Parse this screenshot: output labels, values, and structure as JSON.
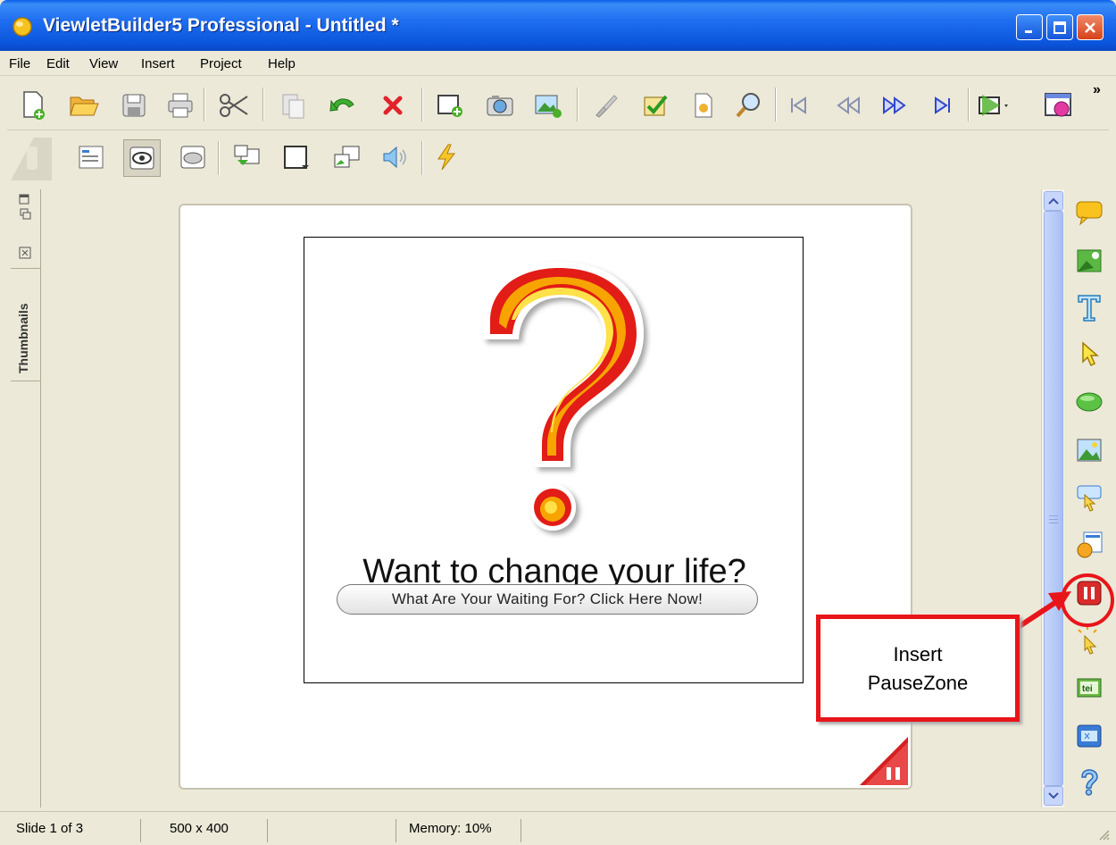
{
  "window": {
    "title": "ViewletBuilder5 Professional - Untitled *",
    "icon": "viewlet-app-icon"
  },
  "menu": [
    "File",
    "Edit",
    "View",
    "Insert",
    "Project",
    "Help"
  ],
  "toolbar_main": {
    "icons": [
      "new-file-icon",
      "open-folder-icon",
      "save-icon",
      "print-icon",
      "cut-icon",
      "paste-icon",
      "undo-icon",
      "delete-icon",
      "add-slide-icon",
      "camera-icon",
      "add-image-icon",
      "brush-icon",
      "spell-check-icon",
      "properties-icon",
      "find-icon",
      "first-slide-icon",
      "rewind-icon",
      "fast-forward-icon",
      "last-slide-icon",
      "preview-icon",
      "publish-icon"
    ],
    "overflow": "»"
  },
  "toolbar_secondary": {
    "icons": [
      "slide-properties-icon",
      "eye-icon",
      "cursor-path-icon",
      "duplicate-slide-icon",
      "frame-dropdown-icon",
      "copy-frame-icon",
      "speaker-icon",
      "lightning-icon"
    ]
  },
  "thumbnails_panel": {
    "label": "Thumbnails"
  },
  "slide": {
    "headline": "Want to change your life?",
    "cta_button": "What Are Your Waiting For? Click Here Now!"
  },
  "right_toolbar": {
    "icons": [
      "callout-icon",
      "image-object-icon",
      "text-icon",
      "cursor-icon",
      "shape-icon",
      "picture-icon",
      "button-icon",
      "flash-object-icon",
      "pausezone-icon",
      "click-zone-icon",
      "text-entry-icon",
      "form-icon",
      "help-icon"
    ]
  },
  "callout": {
    "line1": "Insert",
    "line2": "PauseZone"
  },
  "status": {
    "slide": "Slide 1 of 3",
    "size": "500 x 400",
    "memory": "Memory: 10%"
  },
  "colors": {
    "titlebar": "#0a55dc",
    "background": "#ece9d8",
    "callout_border": "#e8151a"
  }
}
